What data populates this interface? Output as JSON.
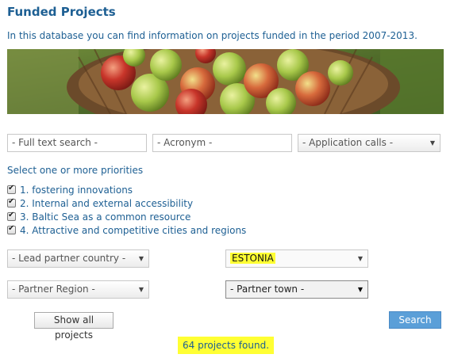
{
  "page": {
    "title": "Funded Projects",
    "intro": "In this database you can find information on projects funded in the period 2007-2013."
  },
  "search": {
    "full_text_placeholder": "- Full text search -",
    "acronym_placeholder": "- Acronym -",
    "application_calls": "- Application calls -"
  },
  "priorities": {
    "heading": "Select one or more priorities",
    "items": [
      {
        "label": "1. fostering innovations",
        "checked": true
      },
      {
        "label": "2. Internal and external accessibility",
        "checked": true
      },
      {
        "label": "3. Baltic Sea as a common resource",
        "checked": true
      },
      {
        "label": "4. Attractive and competitive cities and regions",
        "checked": true
      }
    ]
  },
  "filters": {
    "lead_partner_country": "- Lead partner country -",
    "country_selected": "ESTONIA",
    "partner_region": "- Partner Region -",
    "partner_town": "- Partner town -"
  },
  "buttons": {
    "show_all": "Show all projects",
    "search": "Search"
  },
  "results": {
    "text": "64 projects found."
  },
  "colors": {
    "heading_blue": "#1d5f93",
    "button_blue": "#5b9fd8",
    "highlight": "#ffff33"
  }
}
